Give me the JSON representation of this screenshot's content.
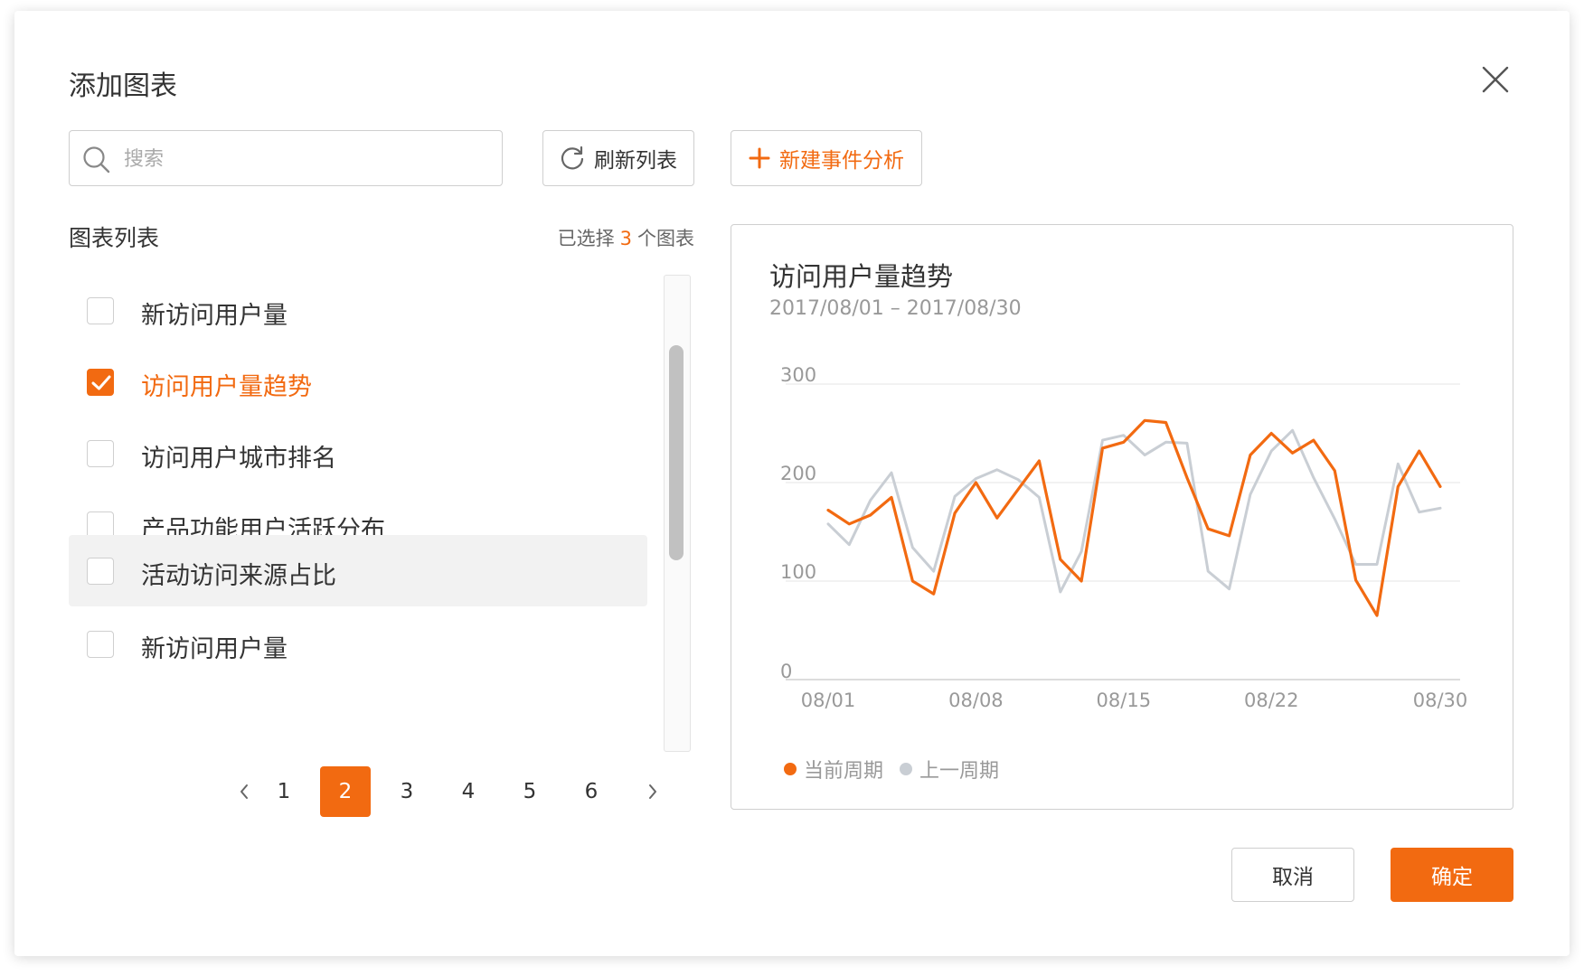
{
  "dialog": {
    "title": "添加图表",
    "search_placeholder": "搜索",
    "refresh_label": "刷新列表",
    "new_label": "新建事件分析",
    "list_title": "图表列表",
    "selected_prefix": "已选择",
    "selected_count": "3",
    "selected_suffix": "个图表",
    "cancel_label": "取消",
    "ok_label": "确定"
  },
  "items": [
    {
      "label": "新访问用户量",
      "checked": false
    },
    {
      "label": "访问用户量趋势",
      "checked": true
    },
    {
      "label": "访问用户城市排名",
      "checked": false
    },
    {
      "label": "产品功能用户活跃分布",
      "checked": false
    },
    {
      "label": "活动访问来源占比",
      "checked": false
    },
    {
      "label": "新访问用户量",
      "checked": false
    }
  ],
  "pagination": {
    "pages": [
      "1",
      "2",
      "3",
      "4",
      "5",
      "6"
    ],
    "current": "2"
  },
  "colors": {
    "accent": "#f26a11",
    "previous": "#c9ced4",
    "grid": "#e6e6e6"
  },
  "chart_data": {
    "type": "line",
    "title": "访问用户量趋势",
    "subtitle": "2017/08/01 – 2017/08/30",
    "x_tick_labels": [
      "08/01",
      "08/08",
      "08/15",
      "08/22",
      "08/30"
    ],
    "y_ticks": [
      0,
      100,
      200,
      300
    ],
    "ylim": [
      0,
      300
    ],
    "x": [
      "08/01",
      "08/02",
      "08/03",
      "08/04",
      "08/05",
      "08/06",
      "08/07",
      "08/08",
      "08/09",
      "08/10",
      "08/11",
      "08/12",
      "08/13",
      "08/14",
      "08/15",
      "08/16",
      "08/17",
      "08/18",
      "08/19",
      "08/20",
      "08/21",
      "08/22",
      "08/23",
      "08/24",
      "08/25",
      "08/26",
      "08/27",
      "08/28",
      "08/29",
      "08/30"
    ],
    "series": [
      {
        "name": "当前周期",
        "color": "#f26a11",
        "values": [
          172,
          158,
          167,
          185,
          100,
          87,
          169,
          200,
          164,
          193,
          222,
          122,
          100,
          235,
          241,
          263,
          261,
          205,
          153,
          146,
          228,
          250,
          230,
          243,
          212,
          101,
          65,
          196,
          232,
          196
        ]
      },
      {
        "name": "上一周期",
        "color": "#c9ced4",
        "values": [
          158,
          137,
          182,
          210,
          134,
          110,
          186,
          204,
          213,
          203,
          185,
          89,
          130,
          243,
          248,
          228,
          241,
          240,
          110,
          92,
          188,
          232,
          253,
          205,
          163,
          117,
          117,
          219,
          170,
          174
        ]
      }
    ],
    "legend_position": "bottom-left",
    "grid": true
  }
}
